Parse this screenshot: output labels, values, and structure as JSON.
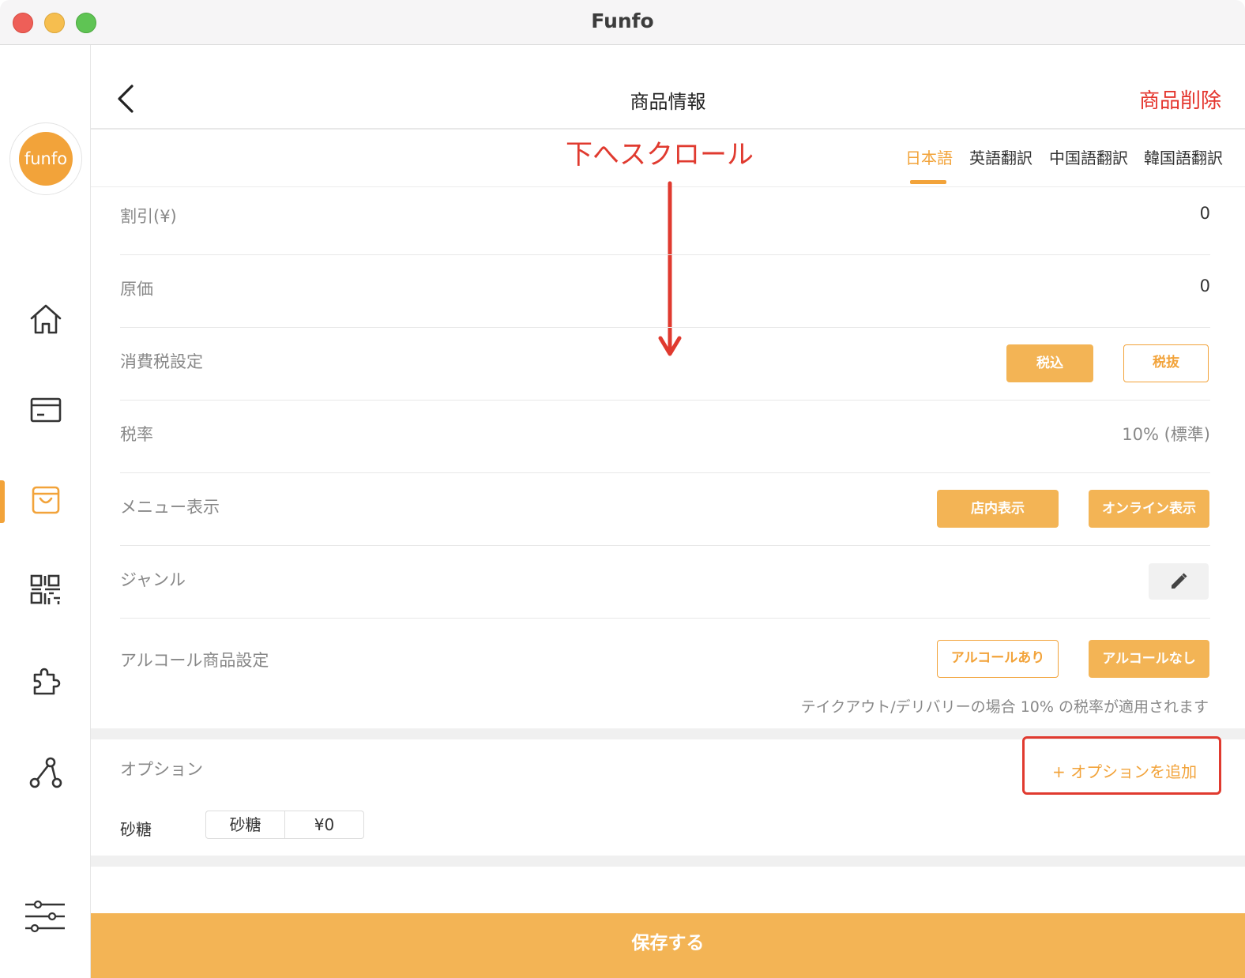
{
  "window": {
    "title": "Funfo"
  },
  "sidebar": {
    "logo_text": "funfo",
    "items": [
      {
        "icon": "home-icon"
      },
      {
        "icon": "card-icon"
      },
      {
        "icon": "shopping-bag-icon",
        "active": true
      },
      {
        "icon": "qr-code-icon"
      },
      {
        "icon": "puzzle-icon"
      },
      {
        "icon": "share-network-icon"
      },
      {
        "icon": "sliders-icon"
      }
    ]
  },
  "header": {
    "title": "商品情報",
    "delete_label": "商品削除"
  },
  "tabs": [
    {
      "label": "日本語",
      "active": true
    },
    {
      "label": "英語翻訳"
    },
    {
      "label": "中国語翻訳"
    },
    {
      "label": "韓国語翻訳"
    }
  ],
  "annotation": {
    "scroll_text": "下へスクロール"
  },
  "form": {
    "discount": {
      "label": "割引(¥)",
      "value": "0"
    },
    "cost": {
      "label": "原価",
      "value": "0"
    },
    "tax_setting": {
      "label": "消費税設定",
      "included_label": "税込",
      "excluded_label": "税抜"
    },
    "tax_rate": {
      "label": "税率",
      "value": "10% (標準)"
    },
    "menu_display": {
      "label": "メニュー表示",
      "store_label": "店内表示",
      "online_label": "オンライン表示"
    },
    "genre": {
      "label": "ジャンル"
    },
    "alcohol": {
      "label": "アルコール商品設定",
      "yes_label": "アルコールあり",
      "no_label": "アルコールなし"
    },
    "note": "テイクアウト/デリバリーの場合 10% の税率が適用されます"
  },
  "options": {
    "label": "オプション",
    "add_label": "+ オプションを追加",
    "items": [
      {
        "group": "砂糖",
        "name": "砂糖",
        "price": "¥0"
      }
    ]
  },
  "footer": {
    "save_label": "保存する"
  },
  "colors": {
    "accent": "#f2a33a",
    "danger": "#e4352d",
    "annotation": "#e03a2f"
  }
}
